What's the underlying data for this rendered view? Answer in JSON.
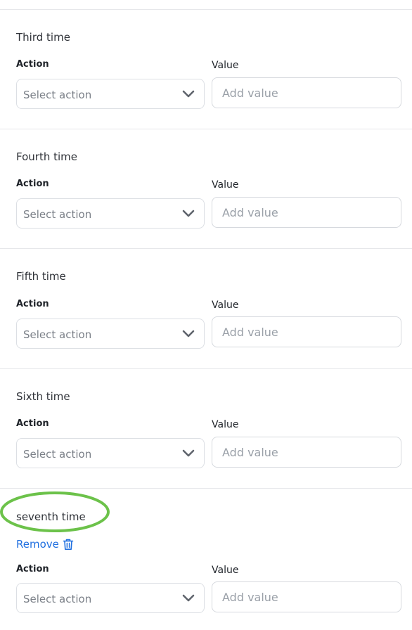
{
  "sections": [
    {
      "title": "Third time",
      "action_label": "Action",
      "value_label": "Value",
      "action_select": "Select action",
      "value_placeholder": "Add value"
    },
    {
      "title": "Fourth time",
      "action_label": "Action",
      "value_label": "Value",
      "action_select": "Select action",
      "value_placeholder": "Add value"
    },
    {
      "title": "Fifth time",
      "action_label": "Action",
      "value_label": "Value",
      "action_select": "Select action",
      "value_placeholder": "Add value"
    },
    {
      "title": "Sixth time",
      "action_label": "Action",
      "value_label": "Value",
      "action_select": "Select action",
      "value_placeholder": "Add value"
    },
    {
      "title": "seventh time",
      "remove_label": "Remove",
      "action_label": "Action",
      "value_label": "Value",
      "action_select": "Select action",
      "value_placeholder": "Add value"
    }
  ],
  "icons": {
    "chevron": "chevron-down-icon",
    "trash": "trash-icon"
  },
  "colors": {
    "highlight_ring": "#6cc24a",
    "link": "#1f6fe0",
    "border": "#dcdfe4",
    "divider": "#e6e7ea"
  }
}
